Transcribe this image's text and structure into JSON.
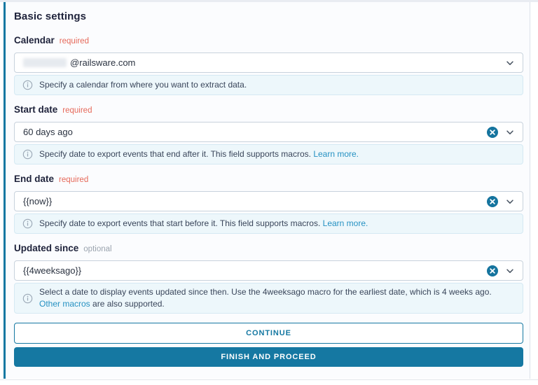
{
  "panel": {
    "title": "Basic settings"
  },
  "colors": {
    "accent": "#1478A2",
    "link": "#2591C2",
    "required": "#E6695A",
    "optional": "#9AA3AE",
    "hint_background": "#EDF7FB"
  },
  "fields": [
    {
      "label": "Calendar",
      "requirement": "required",
      "value": "@railsware.com",
      "hint": {
        "before": "Specify a calendar from where you want to extract data.",
        "link": "",
        "after": ""
      }
    },
    {
      "label": "Start date",
      "requirement": "required",
      "value": "60 days ago",
      "hint": {
        "before": "Specify date to export events that end after it. This field supports macros. ",
        "link": "Learn more.",
        "after": ""
      }
    },
    {
      "label": "End date",
      "requirement": "required",
      "value": "{{now}}",
      "hint": {
        "before": "Specify date to export events that start before it. This field supports macros. ",
        "link": "Learn more.",
        "after": ""
      }
    },
    {
      "label": "Updated since",
      "requirement": "optional",
      "value": "{{4weeksago}}",
      "hint": {
        "before": "Select a date to display events updated since then. Use the 4weeksago macro for the earliest date, which is 4 weeks ago. ",
        "link": "Other macros",
        "after": " are also supported."
      }
    }
  ],
  "buttons": {
    "continue": "CONTINUE",
    "finish": "FINISH AND PROCEED"
  }
}
